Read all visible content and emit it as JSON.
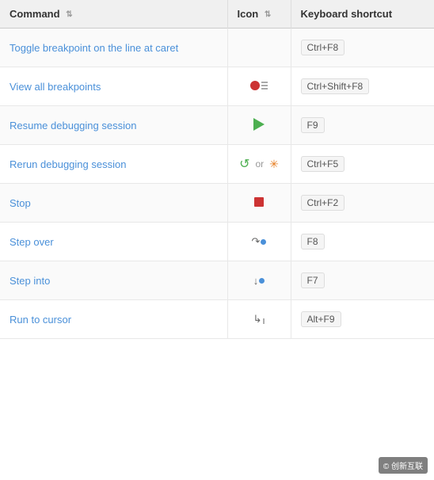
{
  "header": {
    "command_label": "Command",
    "icon_label": "Icon",
    "shortcut_label": "Keyboard shortcut"
  },
  "rows": [
    {
      "id": "toggle-breakpoint",
      "command": "Toggle breakpoint on the line at caret",
      "icon_type": "none",
      "shortcut": "Ctrl+F8"
    },
    {
      "id": "view-breakpoints",
      "command": "View all breakpoints",
      "icon_type": "breakpoint",
      "shortcut": "Ctrl+Shift+F8"
    },
    {
      "id": "resume-debug",
      "command": "Resume debugging session",
      "icon_type": "play",
      "shortcut": "F9"
    },
    {
      "id": "rerun-debug",
      "command": "Rerun debugging session",
      "icon_type": "rerun",
      "shortcut": "Ctrl+F5"
    },
    {
      "id": "stop",
      "command": "Stop",
      "icon_type": "stop",
      "shortcut": "Ctrl+F2"
    },
    {
      "id": "step-over",
      "command": "Step over",
      "icon_type": "stepover",
      "shortcut": "F8"
    },
    {
      "id": "step-into",
      "command": "Step into",
      "icon_type": "stepinto",
      "shortcut": "F7"
    },
    {
      "id": "run-to-cursor",
      "command": "Run to cursor",
      "icon_type": "runtocursor",
      "shortcut": "Alt+F9"
    }
  ],
  "watermark": "© 创新互联"
}
